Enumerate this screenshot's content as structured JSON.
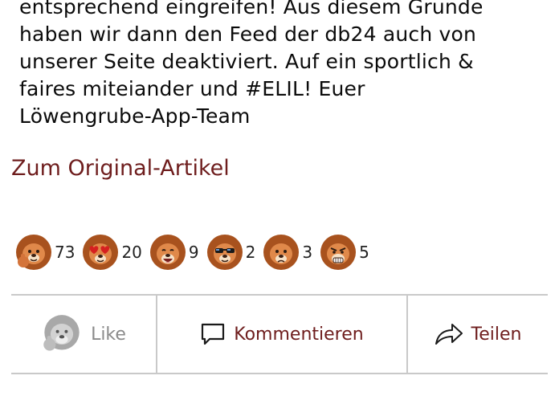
{
  "article": {
    "lines": [
      "entsprechend eingreifen! Aus diesem Grunde",
      "haben wir dann den Feed der db24 auch von",
      "unserer Seite deaktiviert. Auf ein sportlich &",
      "faires miteiander und #ELIL! Euer",
      "Löwengrube-App-Team"
    ]
  },
  "original_link": "Zum Original-Artikel",
  "reactions": [
    {
      "icon": "thumbs-up-lion-icon",
      "count": "73"
    },
    {
      "icon": "heart-eyes-lion-icon",
      "count": "20"
    },
    {
      "icon": "laughing-lion-icon",
      "count": "9"
    },
    {
      "icon": "sunglasses-lion-icon",
      "count": "2"
    },
    {
      "icon": "sad-lion-icon",
      "count": "3"
    },
    {
      "icon": "angry-lion-icon",
      "count": "5"
    }
  ],
  "actions": {
    "like": "Like",
    "comment": "Kommentieren",
    "share": "Teilen"
  },
  "colors": {
    "accent": "#6e1d1d",
    "lion_mane": "#a8521e",
    "lion_face": "#e0894a",
    "divider": "#c9c9c9"
  }
}
